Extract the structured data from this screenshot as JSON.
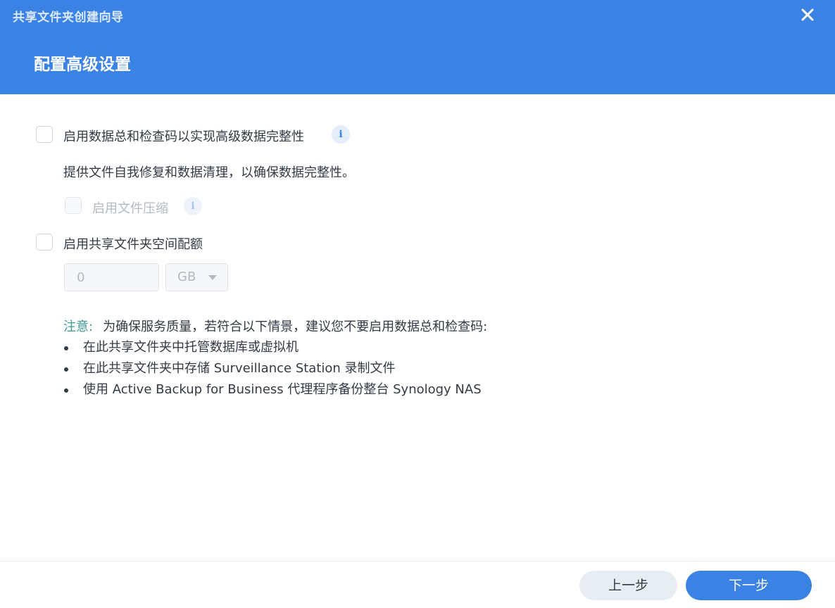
{
  "window": {
    "title": "共享文件夹创建向导",
    "close_icon": "close-icon"
  },
  "step": {
    "title": "配置高级设置"
  },
  "options": {
    "checksum": {
      "label": "启用数据总和检查码以实现高级数据完整性",
      "checked": false,
      "description": "提供文件自我修复和数据清理，以确保数据完整性。",
      "info_icon": "info-icon"
    },
    "compression": {
      "label": "启用文件压缩",
      "checked": false,
      "disabled": true,
      "info_icon": "info-icon"
    },
    "quota": {
      "label": "启用共享文件夹空间配额",
      "checked": false,
      "value": "0",
      "unit": "GB",
      "unit_icon": "caret-down-icon"
    }
  },
  "note": {
    "label": "注意:",
    "text": "为确保服务质量，若符合以下情景，建议您不要启用数据总和检查码:",
    "items": [
      "在此共享文件夹中托管数据库或虚拟机",
      "在此共享文件夹中存储 Surveillance Station 录制文件",
      "使用 Active Backup for Business 代理程序备份整台 Synology NAS"
    ]
  },
  "footer": {
    "prev_label": "上一步",
    "next_label": "下一步"
  },
  "colors": {
    "header_bg": "#3a82e4",
    "note_accent": "#3e9c98",
    "primary_button": "#3a82e4",
    "secondary_button": "#e8edf3"
  }
}
